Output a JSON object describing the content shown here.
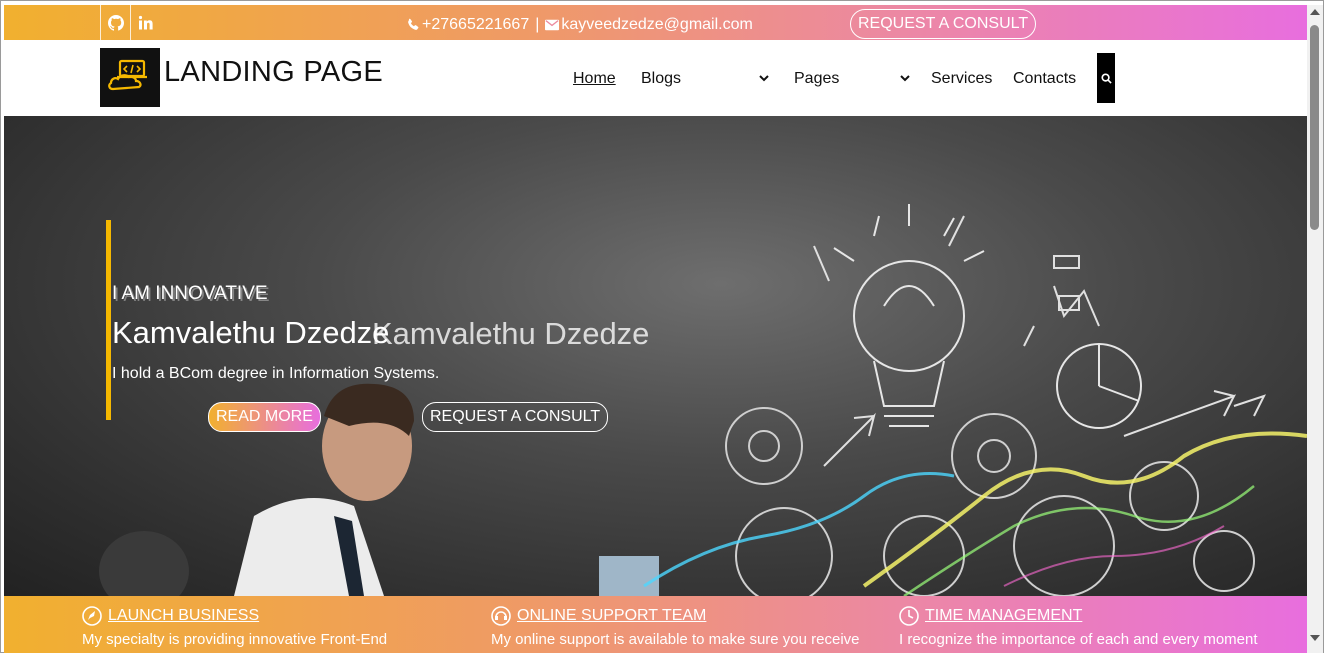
{
  "topbar": {
    "social": [
      {
        "icon": "github-icon"
      },
      {
        "icon": "linkedin-icon"
      }
    ],
    "phone": "+27665221667",
    "separator": "|",
    "email": "kayveedzedze@gmail.com",
    "consult_label": "REQUEST A CONSULT"
  },
  "nav": {
    "brand": "LANDING PAGE",
    "items": {
      "home": "Home",
      "blogs": "Blogs",
      "pages": "Pages",
      "services": "Services",
      "contacts": "Contacts"
    }
  },
  "hero": {
    "eyebrow": "I AM INNOVATIVE",
    "name": "Kamvalethu Dzedze",
    "name_ghost": "Kamvalethu Dzedze",
    "tagline": "I hold a BCom degree in Information Systems.",
    "read_more": "READ MORE",
    "consult": "REQUEST A CONSULT"
  },
  "features": [
    {
      "icon": "rocket-icon",
      "title": "LAUNCH BUSINESS",
      "desc": "My specialty is providing innovative Front-End"
    },
    {
      "icon": "headset-icon",
      "title": "ONLINE SUPPORT TEAM",
      "desc": "My online support is available to make sure you receive"
    },
    {
      "icon": "clock-icon",
      "title": "TIME MANAGEMENT",
      "desc": "I recognize the importance of each and every moment"
    }
  ],
  "colors": {
    "gradient_start": "#f1b02f",
    "gradient_end": "#e86ede",
    "accent_bar": "#f5b800"
  }
}
